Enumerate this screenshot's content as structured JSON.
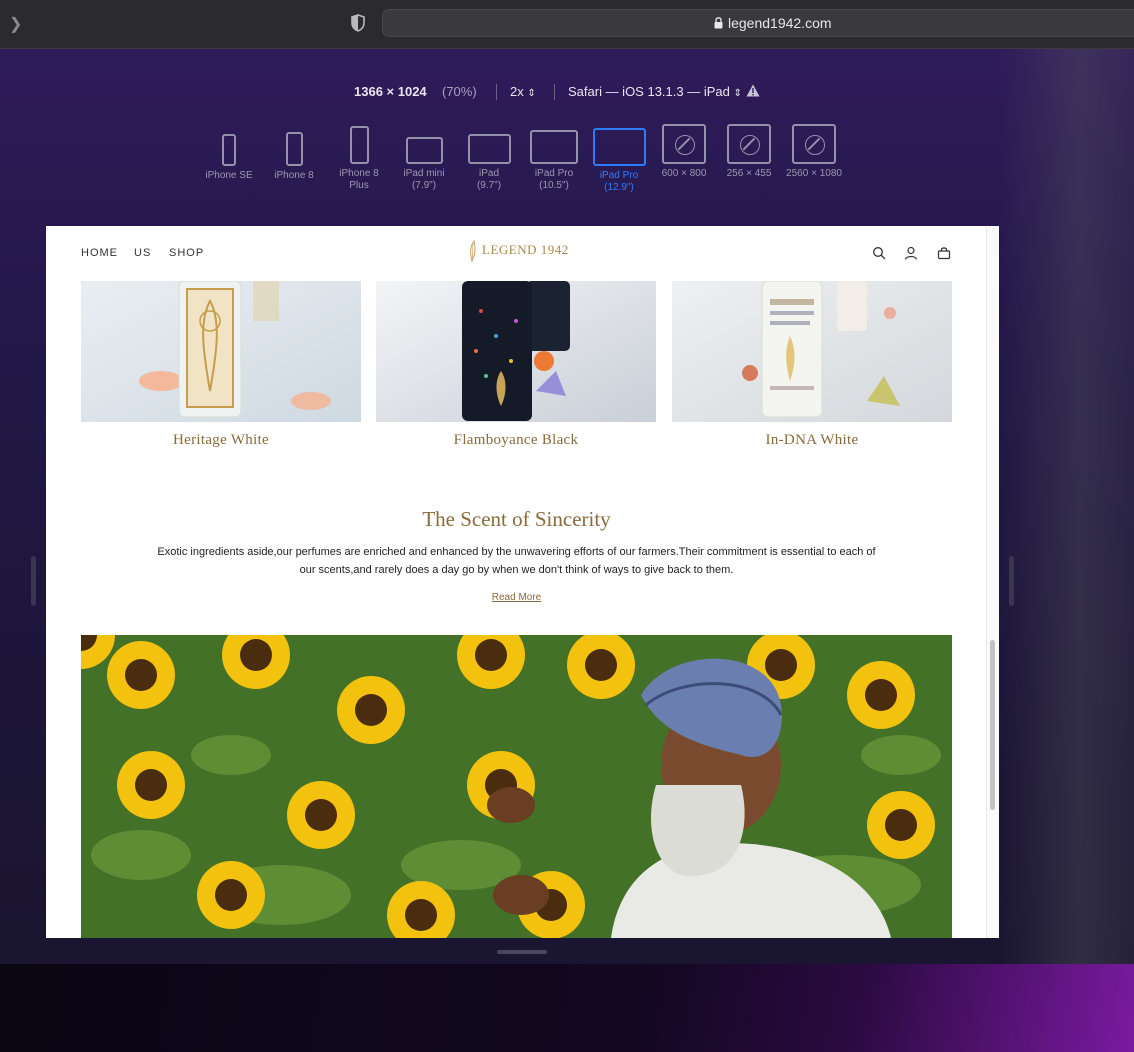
{
  "browser": {
    "url": "legend1942.com"
  },
  "responsive": {
    "dimensions": "1366 × 1024",
    "zoom": "(70%)",
    "pixel_ratio": "2x",
    "user_agent": "Safari — iOS 13.1.3 — iPad",
    "devices": [
      {
        "label": "iPhone SE"
      },
      {
        "label": "iPhone 8"
      },
      {
        "label": "iPhone 8\nPlus"
      },
      {
        "label": "iPad mini\n(7.9\")"
      },
      {
        "label": "iPad\n(9.7\")"
      },
      {
        "label": "iPad Pro\n(10.5\")"
      },
      {
        "label": "iPad Pro\n(12.9\")"
      },
      {
        "label": "600 × 800"
      },
      {
        "label": "256 × 455"
      },
      {
        "label": "2560 × 1080"
      }
    ],
    "active_device": 6
  },
  "site": {
    "nav": {
      "home": "HOME",
      "us": "US",
      "shop": "SHOP"
    },
    "logo": "LEGEND 1942",
    "products": [
      {
        "name": "Heritage White"
      },
      {
        "name": "Flamboyance Black"
      },
      {
        "name": "In-DNA White"
      }
    ],
    "section": {
      "title": "The Scent of Sincerity",
      "body": "Exotic ingredients aside,our perfumes are enriched and enhanced by the unwavering efforts of our farmers.Their commitment is essential to each of our scents,and rarely does a day go by when we don't think of ways to give back to them.",
      "read_more": "Read More"
    }
  },
  "colors": {
    "accent_gold": "#8a6a3a",
    "active_blue": "#2f7bff"
  }
}
